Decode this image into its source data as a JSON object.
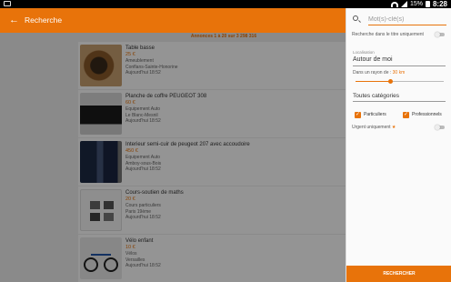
{
  "status_bar": {
    "battery": "15%",
    "time": "8:28"
  },
  "app_bar": {
    "title": "Recherche"
  },
  "results_count": "Annonces 1 à 20 sur 3 298 316",
  "listings": [
    {
      "title": "Table basse",
      "price": "25 €",
      "category": "Ameublement",
      "location": "Conflans-Sainte-Honorine",
      "date": "Aujourd'hui 18:52"
    },
    {
      "title": "Planche de coffre PEUGEOT 308",
      "price": "60 €",
      "category": "Equipement Auto",
      "location": "Le Blanc-Mesnil",
      "date": "Aujourd'hui 18:52"
    },
    {
      "title": "Interieur semi-cuir de peugeot 207 avec accoudoire",
      "price": "450 €",
      "category": "Equipement Auto",
      "location": "Amboy-sous-Bois",
      "date": "Aujourd'hui 18:52"
    },
    {
      "title": "Cours-soutien de maths",
      "price": "20 €",
      "category": "Cours particuliers",
      "location": "Paris 19ème",
      "date": "Aujourd'hui 18:52"
    },
    {
      "title": "Vélo enfant",
      "price": "10 €",
      "category": "Vélos",
      "location": "Versailles",
      "date": "Aujourd'hui 18:52"
    }
  ],
  "filters": {
    "search_placeholder": "Mot(s)-clé(s)",
    "title_only_label": "Recherche dans le titre uniquement",
    "location_label": "Localisation",
    "location_value": "Autour de moi",
    "radius_label": "Dans un rayon de :",
    "radius_value": "30 km",
    "radius_fraction": 0.4,
    "category_value": "Toutes catégories",
    "particuliers_label": "Particuliers",
    "professionnels_label": "Professionnels",
    "urgent_label": "Urgent uniquement",
    "search_button": "RECHERCHER"
  },
  "colors": {
    "accent": "#e8730a"
  }
}
